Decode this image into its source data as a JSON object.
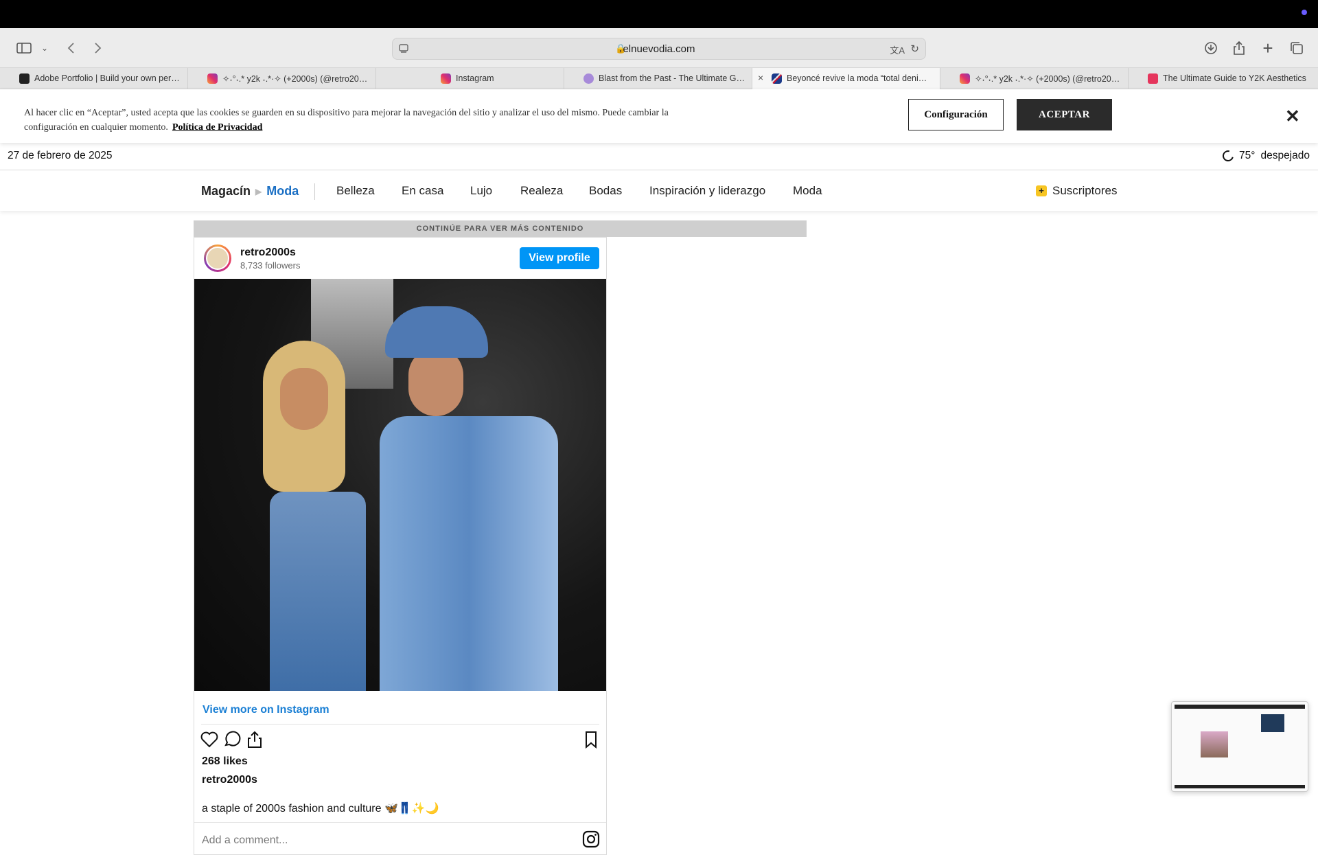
{
  "browser": {
    "url": "elnuevodia.com",
    "tabs": [
      {
        "title": "Adobe Portfolio | Build your own per…",
        "icon": "adobe-portfolio-favicon",
        "active": false
      },
      {
        "title": "✧˖°˖.* y2k ˖.*·✧ (+2000s) (@retro20…",
        "icon": "instagram-favicon",
        "active": false
      },
      {
        "title": "Instagram",
        "icon": "instagram-favicon",
        "active": false
      },
      {
        "title": "Blast from the Past - The Ultimate G…",
        "icon": "blast-favicon",
        "active": false
      },
      {
        "title": "Beyoncé revive la moda “total deni…",
        "icon": "uk-flag-favicon",
        "active": true
      },
      {
        "title": "✧˖°˖.* y2k ˖.*·✧ (+2000s) (@retro20…",
        "icon": "instagram-favicon",
        "active": false
      },
      {
        "title": "The Ultimate Guide to Y2K Aesthetics",
        "icon": "she-favicon",
        "active": false
      }
    ]
  },
  "cookie": {
    "text": "Al hacer clic en “Aceptar”, usted acepta que las cookies se guarden en su dispositivo para mejorar la navegación del sitio y analizar el uso del mismo. Puede cambiar la configuración en cualquier momento.",
    "link": "Política de Privacidad",
    "config_label": "Configuración",
    "accept_label": "ACEPTAR",
    "close": "✕"
  },
  "datebar": {
    "date": "27 de febrero de 2025",
    "temp": "75°",
    "condition": "despejado"
  },
  "nav": {
    "section": "Magacín",
    "current": "Moda",
    "items": [
      "Belleza",
      "En casa",
      "Lujo",
      "Realeza",
      "Bodas",
      "Inspiración y liderazgo",
      "Moda"
    ],
    "subscribers": "Suscriptores"
  },
  "continue_text": "CONTINÚE PARA VER MÁS CONTENIDO",
  "instagram": {
    "username": "retro2000s",
    "followers": "8,733 followers",
    "view_profile": "View profile",
    "view_more": "View more on Instagram",
    "likes": "268 likes",
    "caption_user": "retro2000s",
    "caption": "a staple of 2000s fashion and culture 🦋👖✨🌙",
    "comment_placeholder": "Add a comment..."
  },
  "colors": {
    "accent_blue": "#1a6fc4",
    "instagram_blue": "#0095f6",
    "accept_bg": "#2b2b2b"
  }
}
